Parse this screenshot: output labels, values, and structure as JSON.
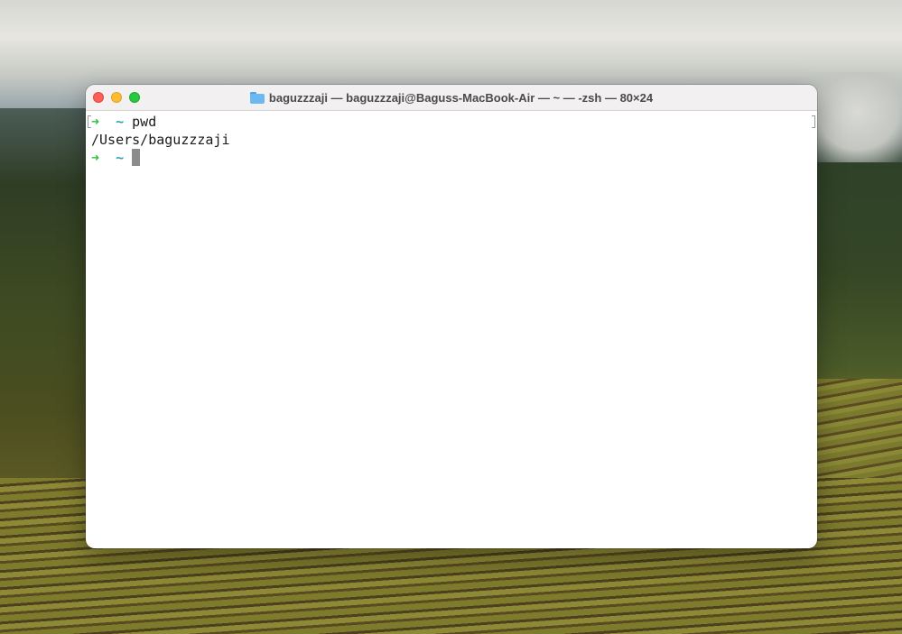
{
  "window": {
    "title": "baguzzzaji — baguzzzaji@Baguss-MacBook-Air — ~ — -zsh — 80×24",
    "title_icon": "folder-icon",
    "traffic_lights": {
      "close_color": "#fe5f57",
      "minimize_color": "#febc2e",
      "zoom_color": "#28c840"
    }
  },
  "terminal": {
    "lines": [
      {
        "arrow": "➜",
        "dir": "~",
        "command": "pwd"
      },
      {
        "output": "/Users/baguzzzaji"
      },
      {
        "arrow": "➜",
        "dir": "~",
        "command": ""
      }
    ],
    "prompt_arrow_color": "#2fbf3c",
    "prompt_dir_color": "#2aa3b5"
  }
}
